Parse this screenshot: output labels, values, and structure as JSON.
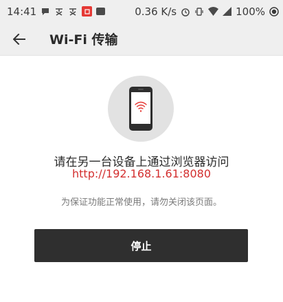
{
  "status_bar": {
    "time": "14:41",
    "notif_icons": [
      "message-icon",
      "app-icon-1",
      "app-icon-2",
      "news-icon",
      "image-icon"
    ],
    "network_speed": "0.36 K/s",
    "battery": "100%"
  },
  "app_bar": {
    "title": "Wi-Fi 传输"
  },
  "content": {
    "instruction": "请在另一台设备上通过浏览器访问",
    "url": "http://192.168.1.61:8080",
    "warning": "为保证功能正常使用，请勿关闭该页面。"
  },
  "actions": {
    "stop_label": "停止"
  },
  "colors": {
    "accent": "#d32f2f",
    "button": "#2f2f2f",
    "bar": "#efefef"
  }
}
